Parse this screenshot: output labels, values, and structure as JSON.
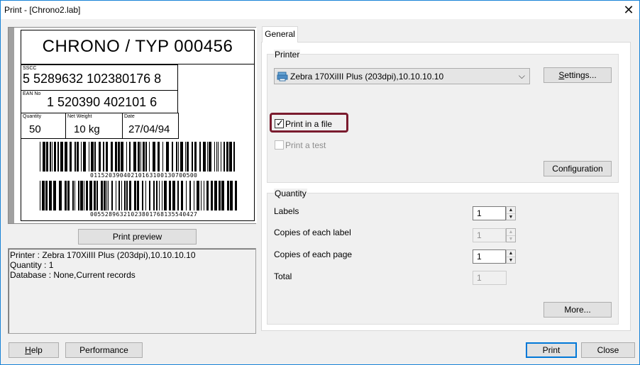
{
  "window": {
    "title": "Print - [Chrono2.lab]",
    "close_glyph": "✕"
  },
  "label": {
    "header": "CHRONO / TYP 000456",
    "sscc_caption": "SSCC",
    "sscc_value": "5 5289632 102380176 8",
    "ean_caption": "EAN No",
    "ean_value": "1 520390 402101 6",
    "quantity_caption": "Quantity",
    "quantity_value": "50",
    "weight_caption": "Net Weight",
    "weight_value": "10 kg",
    "date_caption": "Date",
    "date_value": "27/04/94",
    "barcode1_text": "01152039040210163100130700500",
    "barcode2_text": "00552896321023801768135540427"
  },
  "preview": {
    "button_label": "Print preview"
  },
  "summary": {
    "printer_line": "Printer : Zebra 170XiIII Plus (203dpi),10.10.10.10",
    "quantity_line": "Quantity : 1",
    "database_line": "Database : None,Current records"
  },
  "tabs": [
    {
      "label": "General",
      "selected": true
    }
  ],
  "printer_group": {
    "title": "Printer",
    "selected_printer": "Zebra 170XiIII Plus (203dpi),10.10.10.10",
    "settings_label": "Settings...",
    "print_in_file_label": "Print in a file",
    "print_in_file_checked": true,
    "print_test_label": "Print a test",
    "print_test_checked": false,
    "configuration_label": "Configuration"
  },
  "quantity_group": {
    "title": "Quantity",
    "labels_label": "Labels",
    "labels_value": "1",
    "copies_label_label": "Copies of each label",
    "copies_label_value": "1",
    "copies_page_label": "Copies of each page",
    "copies_page_value": "1",
    "total_label": "Total",
    "total_value": "1",
    "more_label": "More..."
  },
  "footer": {
    "help_label": "Help",
    "performance_label": "Performance",
    "print_label": "Print",
    "close_label": "Close"
  },
  "colors": {
    "highlight": "#7a1b2e",
    "default_button_border": "#0078d7"
  }
}
